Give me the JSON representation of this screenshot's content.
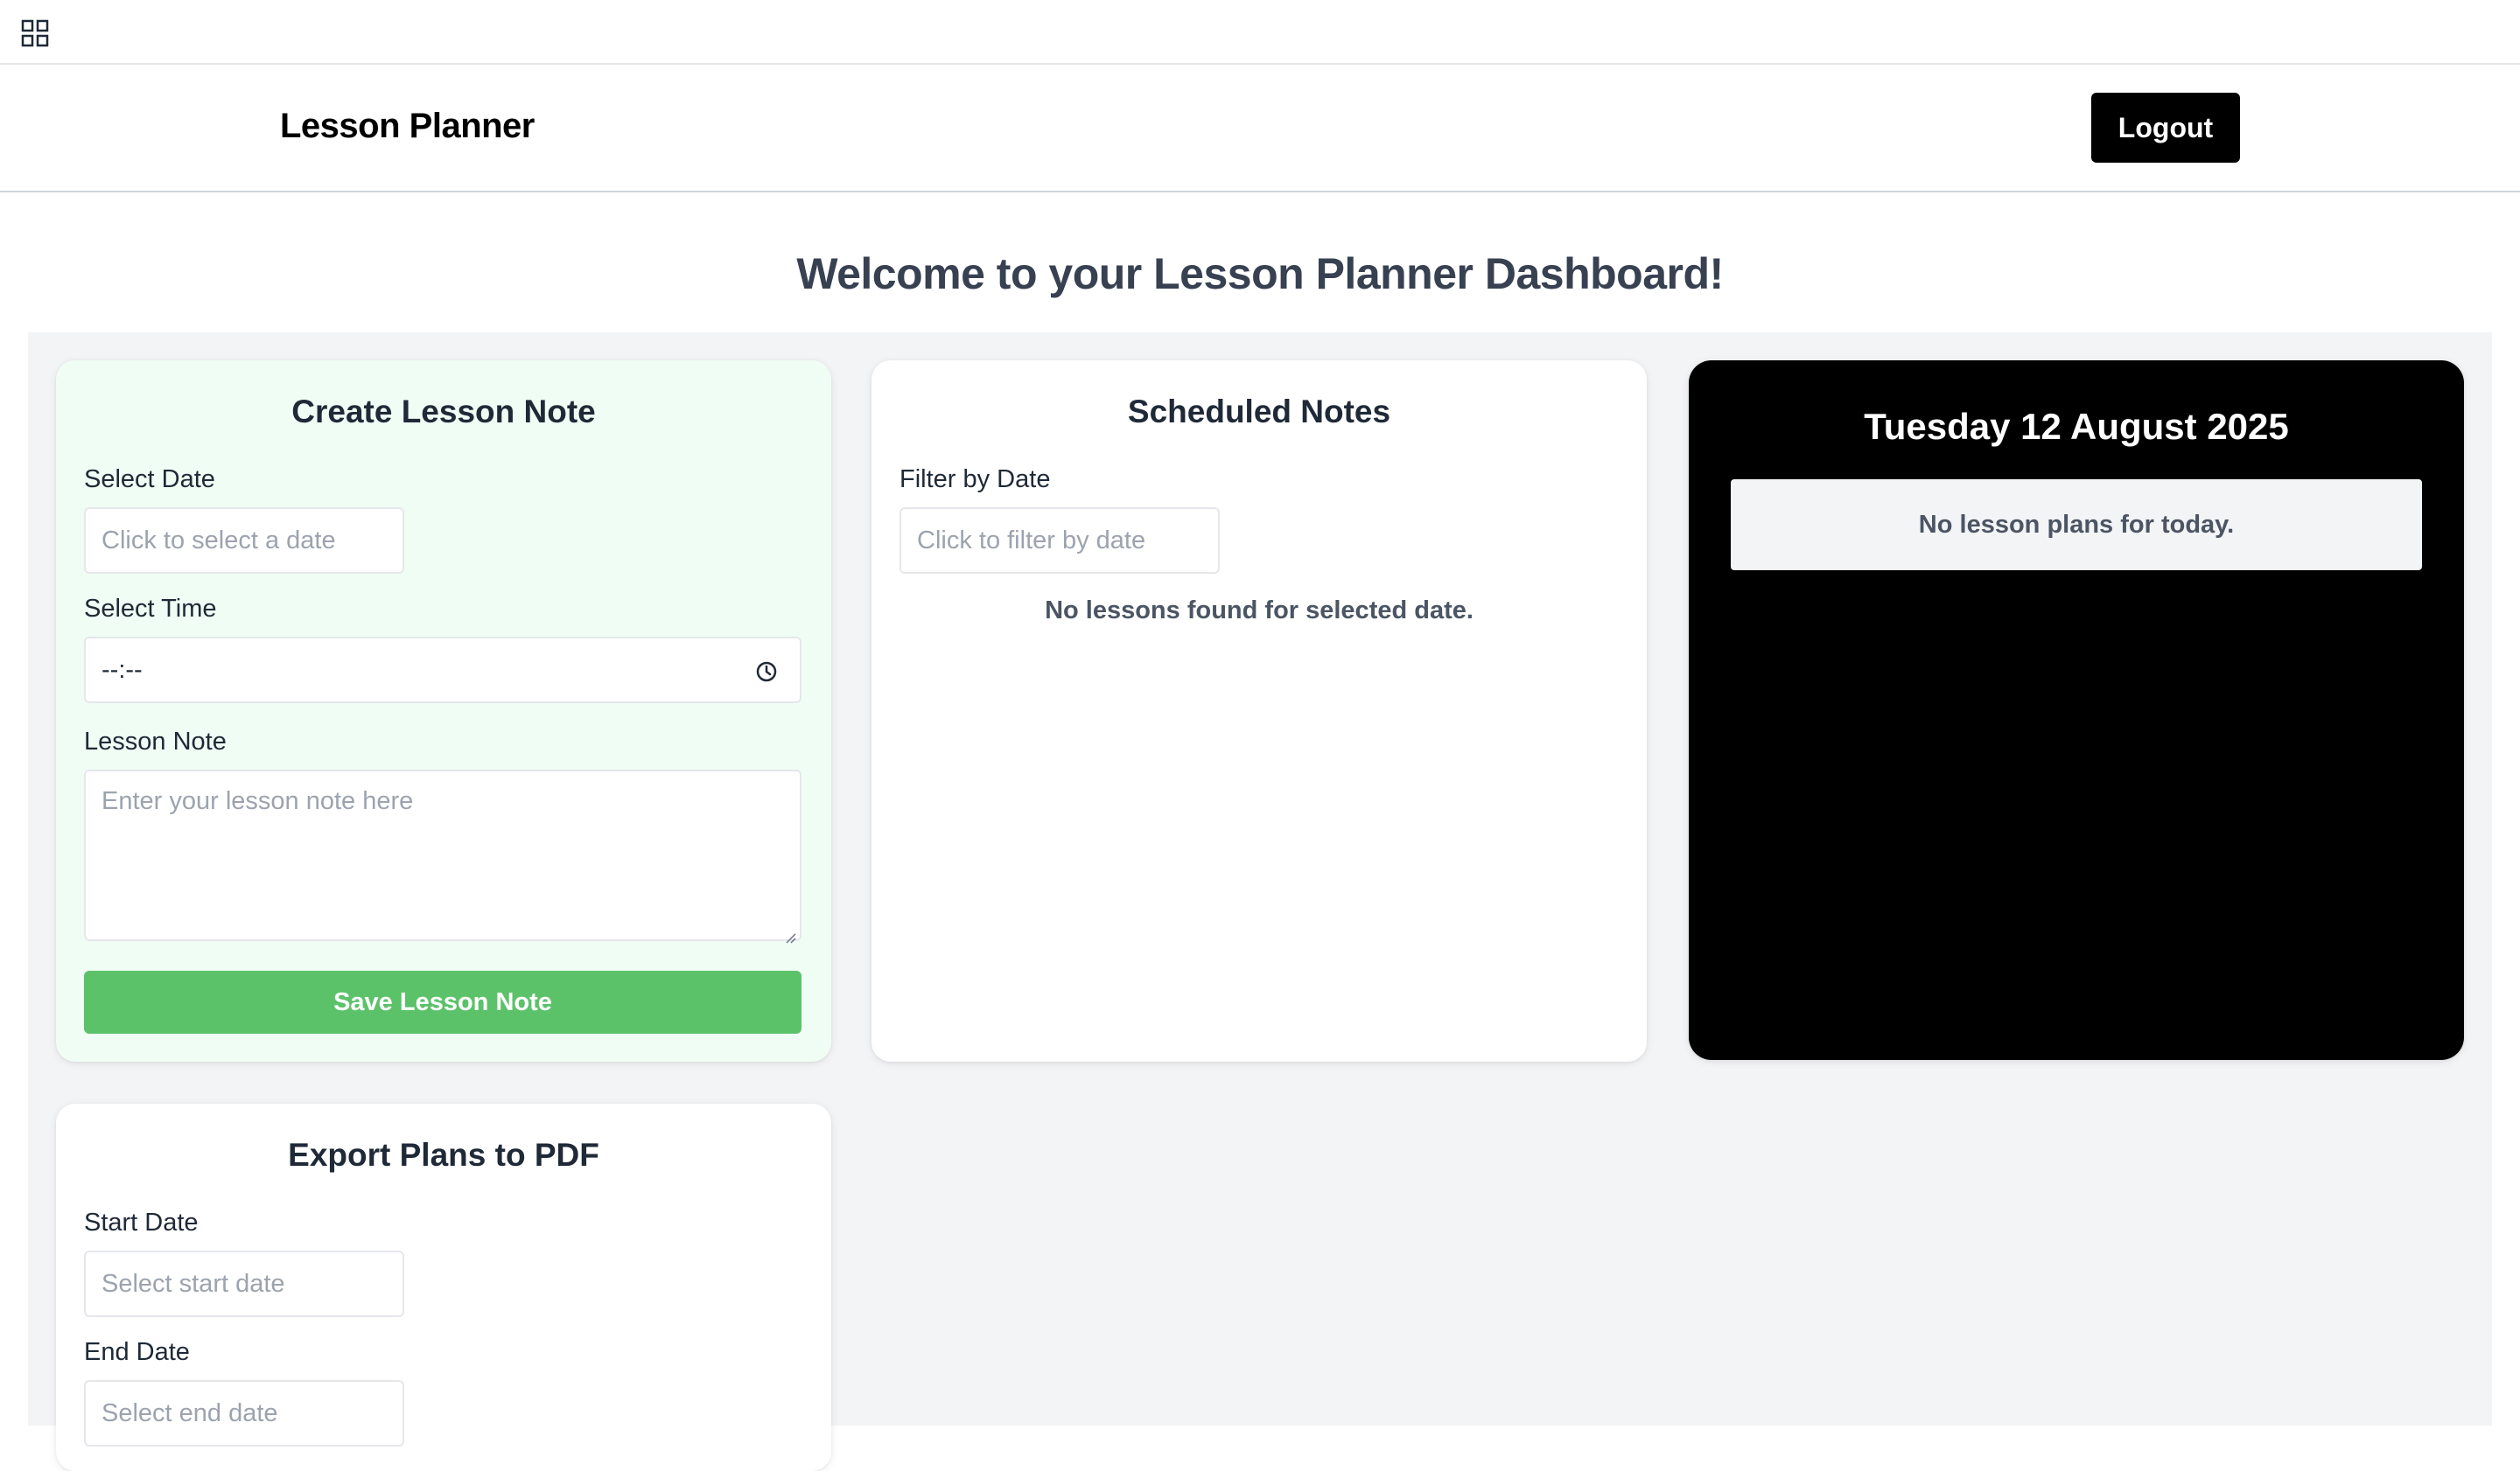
{
  "topbar": {
    "apps_icon": "grid-icon"
  },
  "header": {
    "brand": "Lesson Planner",
    "logout_label": "Logout"
  },
  "page": {
    "title": "Welcome to your Lesson Planner Dashboard!"
  },
  "create_note": {
    "title": "Create Lesson Note",
    "date_label": "Select Date",
    "date_placeholder": "Click to select a date",
    "time_label": "Select Time",
    "time_value": "--:--",
    "note_label": "Lesson Note",
    "note_placeholder": "Enter your lesson note here",
    "save_label": "Save Lesson Note"
  },
  "scheduled": {
    "title": "Scheduled Notes",
    "filter_label": "Filter by Date",
    "filter_placeholder": "Click to filter by date",
    "empty_message": "No lessons found for selected date."
  },
  "today": {
    "date": "Tuesday 12 August 2025",
    "message": "No lesson plans for today."
  },
  "export": {
    "title": "Export Plans to PDF",
    "start_label": "Start Date",
    "start_placeholder": "Select start date",
    "end_label": "End Date",
    "end_placeholder": "Select end date"
  },
  "colors": {
    "accent_green": "#5cc26a",
    "create_card_bg": "#f0fdf4",
    "workspace_bg": "#f3f4f6",
    "today_card_bg": "#000000"
  }
}
